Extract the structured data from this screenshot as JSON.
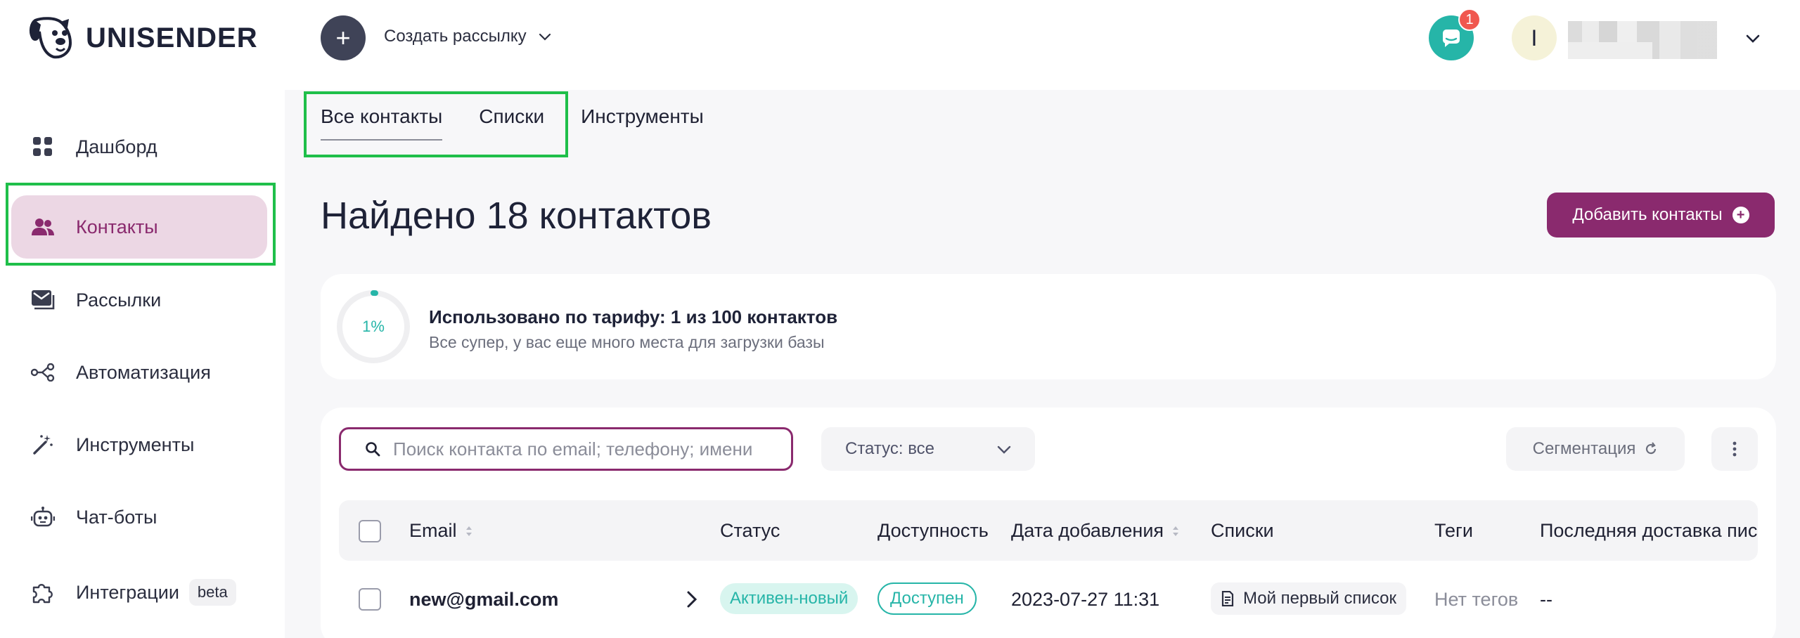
{
  "brand": {
    "name": "UNISENDER"
  },
  "header": {
    "create_label": "Создать рассылку",
    "notification_count": "1",
    "user_initial": "I"
  },
  "sidebar": {
    "items": [
      {
        "id": "dashboard",
        "label": "Дашборд",
        "icon": "dashboard-icon"
      },
      {
        "id": "contacts",
        "label": "Контакты",
        "icon": "contacts-icon",
        "active": true
      },
      {
        "id": "mailings",
        "label": "Рассылки",
        "icon": "mail-icon"
      },
      {
        "id": "automation",
        "label": "Автоматизация",
        "icon": "automation-icon"
      },
      {
        "id": "tools",
        "label": "Инструменты",
        "icon": "magic-wand-icon"
      },
      {
        "id": "chatbots",
        "label": "Чат-боты",
        "icon": "robot-icon"
      },
      {
        "id": "integrations",
        "label": "Интеграции",
        "icon": "puzzle-icon",
        "badge": "beta"
      }
    ]
  },
  "tabs": [
    {
      "label": "Все контакты",
      "active": true
    },
    {
      "label": "Списки"
    },
    {
      "label": "Инструменты"
    }
  ],
  "main": {
    "title": "Найдено 18 контактов",
    "add_button": "Добавить контакты",
    "usage": {
      "percent_label": "1%",
      "percent_value": 1,
      "title": "Использовано по тарифу: 1 из 100 контактов",
      "subtitle": "Все супер, у вас еще много места для загрузки базы"
    },
    "search_placeholder": "Поиск контакта по email; телефону; имени",
    "status_filter": "Статус: все",
    "segmentation": "Сегментация"
  },
  "table": {
    "columns": [
      "Email",
      "Статус",
      "Доступность",
      "Дата добавления",
      "Списки",
      "Теги",
      "Последняя доставка пис"
    ],
    "rows": [
      {
        "email": "new@gmail.com",
        "status": "Активен-новый",
        "availability": "Доступен",
        "date": "2023-07-27 11:31",
        "list": "Мой первый список",
        "tags": "Нет тегов",
        "last_delivery": "--"
      }
    ]
  },
  "colors": {
    "brand": "#8a2a6e",
    "accent_teal": "#26b5a8",
    "highlight_green": "#1fbf4a",
    "badge_red": "#f0584f"
  }
}
